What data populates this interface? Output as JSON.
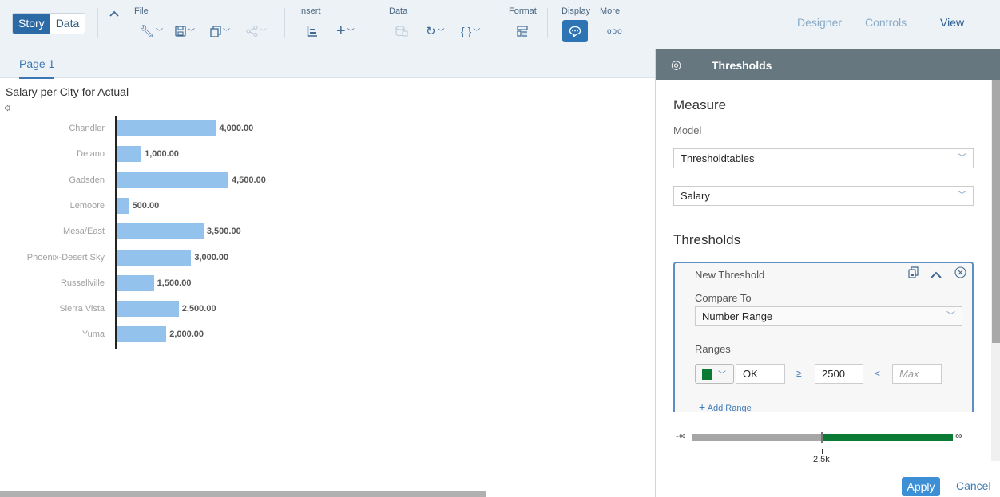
{
  "toolbar": {
    "story_label": "Story",
    "data_label": "Data",
    "collapse_icon": "chevron-up",
    "groups": {
      "file": "File",
      "insert": "Insert",
      "data": "Data",
      "format": "Format",
      "display": "Display",
      "more": "More"
    },
    "icons": {
      "tools": "wrench",
      "save": "floppy-disk",
      "copy": "copy",
      "share": "share",
      "chart": "bar-chart",
      "add": "plus",
      "data_source": "database",
      "refresh": "refresh",
      "formula": "curly-braces",
      "styling": "layout",
      "comment": "speech-bubble",
      "more": "ellipsis"
    },
    "modes": {
      "designer": "Designer",
      "controls": "Controls",
      "view": "View"
    }
  },
  "page": {
    "tab_label": "Page 1"
  },
  "chart_data": {
    "type": "bar",
    "orientation": "horizontal",
    "title": "Salary per City for Actual",
    "xlabel": "",
    "ylabel": "",
    "categories": [
      "Chandler",
      "Delano",
      "Gadsden",
      "Lemoore",
      "Mesa/East",
      "Phoenix-Desert Sky",
      "Russellville",
      "Sierra Vista",
      "Yuma"
    ],
    "values": [
      4000,
      1000,
      4500,
      500,
      3500,
      3000,
      1500,
      2500,
      2000
    ],
    "value_labels": [
      "4,000.00",
      "1,000.00",
      "4,500.00",
      "500.00",
      "3,500.00",
      "3,000.00",
      "1,500.00",
      "2,500.00",
      "2,000.00"
    ],
    "xlim": [
      0,
      4500
    ],
    "bar_color": "#93c2ec",
    "grid": false
  },
  "panel": {
    "title": "Thresholds",
    "measure_title": "Measure",
    "model_label": "Model",
    "model_value": "Thresholdtables",
    "measure_value": "Salary",
    "thresholds_title": "Thresholds",
    "threshold": {
      "name": "New Threshold",
      "compare_label": "Compare To",
      "compare_value": "Number Range",
      "ranges_label": "Ranges",
      "range": {
        "color": "#0a7a35",
        "name": "OK",
        "op_lower": "≥",
        "lower": "2500",
        "op_upper": "<",
        "upper_placeholder": "Max"
      },
      "add_range": "Add Range"
    },
    "range_bar": {
      "neg_inf": "-∞",
      "pos_inf": "∞",
      "tick_label": "2.5k",
      "below_color": "#a6a6a6",
      "above_color": "#0a7a35"
    },
    "apply": "Apply",
    "cancel": "Cancel"
  }
}
